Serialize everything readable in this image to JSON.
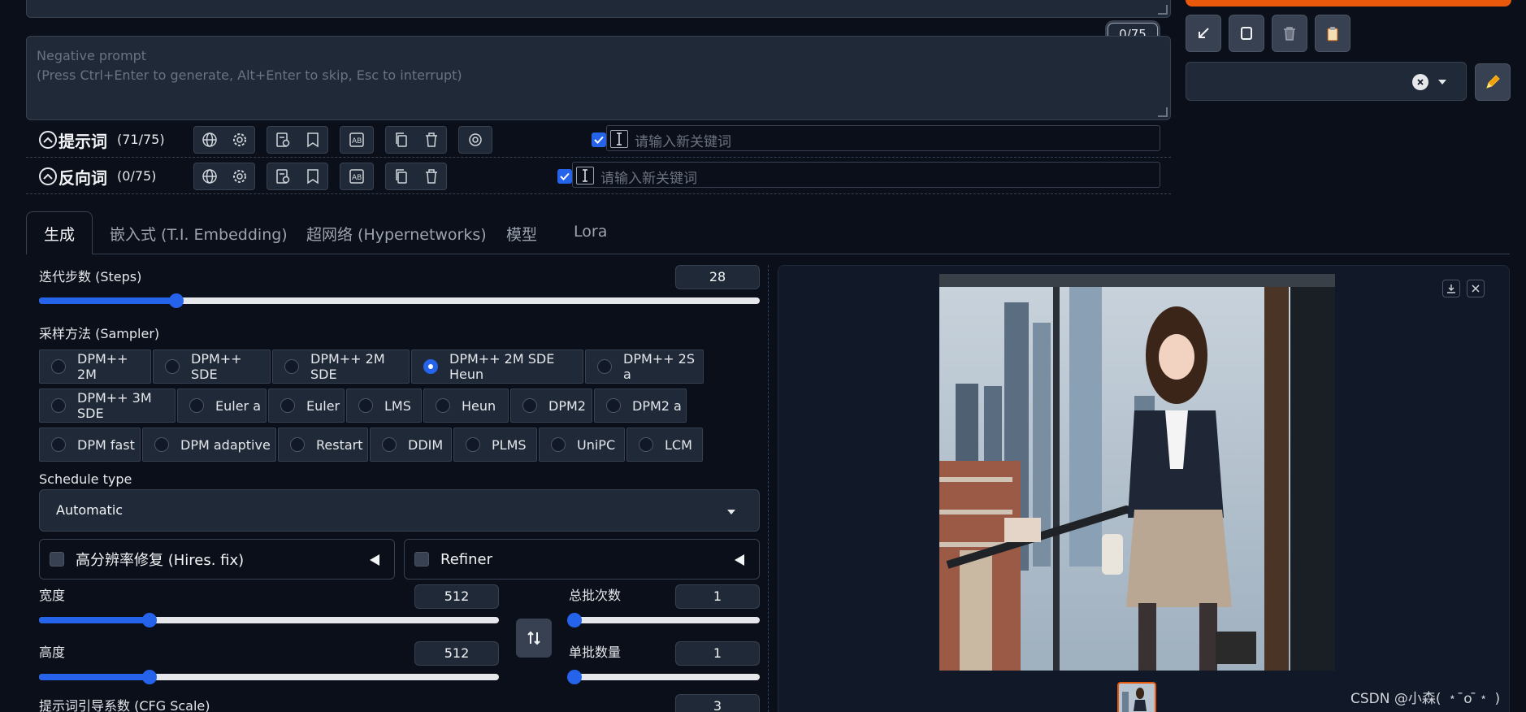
{
  "prompt_area": {
    "token_counter": "0/75"
  },
  "negative_prompt": {
    "placeholder_line1": "Negative prompt",
    "placeholder_line2": "(Press Ctrl+Enter to generate, Alt+Enter to skip, Esc to interrupt)"
  },
  "prompt_toolbar": {
    "title": "提示词",
    "count": "(71/75)",
    "keyword_placeholder": "请输入新关键词"
  },
  "negative_toolbar": {
    "title": "反向词",
    "count": "(0/75)",
    "keyword_placeholder": "请输入新关键词"
  },
  "tabs": [
    {
      "label": "生成",
      "active": true
    },
    {
      "label": "嵌入式 (T.I. Embedding)",
      "active": false
    },
    {
      "label": "超网络 (Hypernetworks)",
      "active": false
    },
    {
      "label": "模型",
      "active": false
    },
    {
      "label": "Lora",
      "active": false
    }
  ],
  "steps": {
    "label": "迭代步数 (Steps)",
    "value": "28",
    "fraction": 0.19
  },
  "sampler": {
    "label": "采样方法 (Sampler)",
    "selected": "DPM++ 2M SDE Heun",
    "rows": [
      [
        "DPM++ 2M",
        "DPM++ SDE",
        "DPM++ 2M SDE",
        "DPM++ 2M SDE Heun",
        "DPM++ 2S a"
      ],
      [
        "DPM++ 3M SDE",
        "Euler a",
        "Euler",
        "LMS",
        "Heun",
        "DPM2",
        "DPM2 a"
      ],
      [
        "DPM fast",
        "DPM adaptive",
        "Restart",
        "DDIM",
        "PLMS",
        "UniPC",
        "LCM"
      ]
    ]
  },
  "schedule": {
    "label": "Schedule type",
    "value": "Automatic"
  },
  "hires": {
    "label": "高分辨率修复 (Hires. fix)",
    "checked": false
  },
  "refiner": {
    "label": "Refiner",
    "checked": false
  },
  "width": {
    "label": "宽度",
    "value": "512",
    "fraction": 0.24
  },
  "height": {
    "label": "高度",
    "value": "512",
    "fraction": 0.24
  },
  "batch_count": {
    "label": "总批次数",
    "value": "1",
    "fraction": 0.0
  },
  "batch_size": {
    "label": "单批数量",
    "value": "1",
    "fraction": 0.0
  },
  "cfg": {
    "label": "提示词引导系数 (CFG Scale)",
    "value": "3"
  },
  "watermark": "CSDN @小森( ﹡ ̄o ̄﹡ )",
  "colors": {
    "accent": "#2563eb",
    "orange": "#ea580c",
    "bg": "#0b0f19",
    "panel": "#1f2937"
  }
}
